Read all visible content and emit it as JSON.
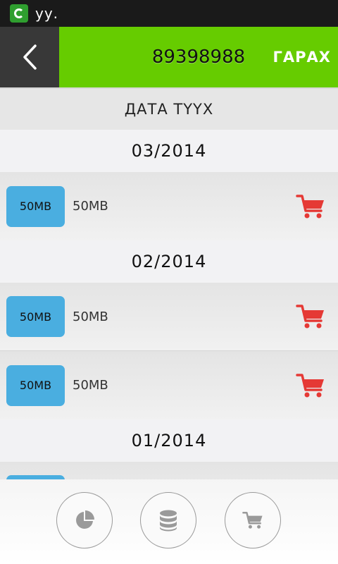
{
  "status_bar": {
    "text": "уу."
  },
  "header": {
    "title": "89398988",
    "exit_label": "ГАРАХ"
  },
  "list": {
    "title": "ДАТА ТҮҮХ",
    "groups": [
      {
        "month": "03/2014",
        "items": [
          {
            "badge": "50MB",
            "label": "50MB"
          }
        ]
      },
      {
        "month": "02/2014",
        "items": [
          {
            "badge": "50MB",
            "label": "50MB"
          },
          {
            "badge": "50MB",
            "label": "50MB"
          }
        ]
      },
      {
        "month": "01/2014",
        "items": [
          {
            "badge": "",
            "label": ""
          }
        ]
      }
    ]
  },
  "colors": {
    "accent_green": "#66cc00",
    "badge_blue": "#4aaee0",
    "cart_red": "#e53935",
    "header_dark": "#383838"
  },
  "bottom_nav": {
    "icons": [
      "pie-chart-icon",
      "database-icon",
      "cart-icon"
    ]
  }
}
